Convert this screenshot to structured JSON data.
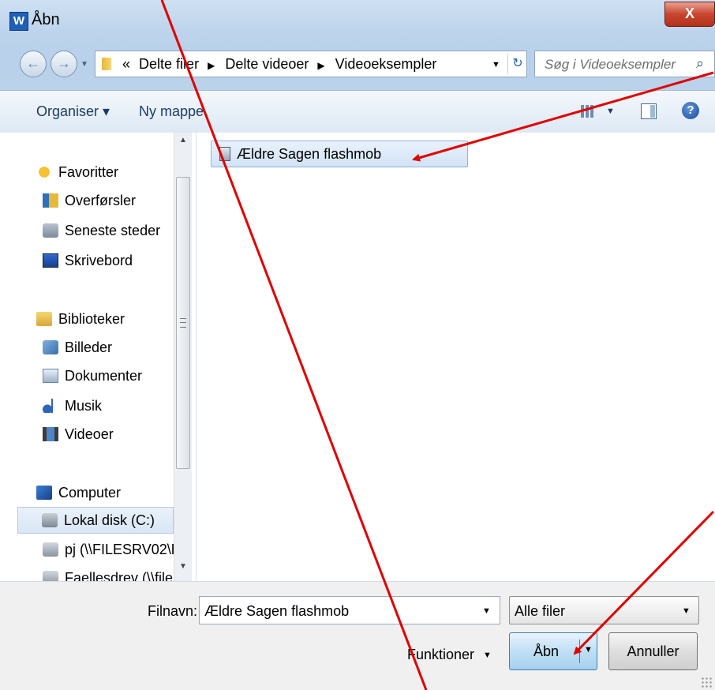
{
  "window": {
    "title": "Åbn",
    "app_icon_letter": "W",
    "close_label": "X"
  },
  "address_bar": {
    "overflow_marker": "«",
    "breadcrumbs": [
      "Delte filer",
      "Delte videoer",
      "Videoeksempler"
    ],
    "separator": "▶"
  },
  "search": {
    "placeholder": "Søg i Videoeksempler"
  },
  "toolbar": {
    "organize_label": "Organiser ▾",
    "new_folder_label": "Ny mappe"
  },
  "nav": {
    "items": [
      {
        "label": "Favoritter",
        "icon": "star-icon"
      },
      {
        "label": "Overførsler",
        "icon": "downloads-folder-icon"
      },
      {
        "label": "Seneste steder",
        "icon": "recent-places-icon"
      },
      {
        "label": "Skrivebord",
        "icon": "desktop-icon"
      },
      {
        "label": "Biblioteker",
        "icon": "libraries-icon"
      },
      {
        "label": "Billeder",
        "icon": "pictures-icon"
      },
      {
        "label": "Dokumenter",
        "icon": "documents-icon"
      },
      {
        "label": "Musik",
        "icon": "music-icon"
      },
      {
        "label": "Videoer",
        "icon": "videos-icon"
      },
      {
        "label": "Computer",
        "icon": "computer-icon"
      },
      {
        "label": "Lokal disk (C:)",
        "icon": "local-disk-icon",
        "selected": true
      },
      {
        "label": "pj (\\\\FILESRV02\\H",
        "icon": "network-drive-icon"
      },
      {
        "label": "Faellesdrev (\\\\file",
        "icon": "network-drive-icon"
      }
    ]
  },
  "files": [
    {
      "name": "Ældre Sagen flashmob",
      "icon": "video-file-icon",
      "selected": true
    }
  ],
  "bottom": {
    "filename_label": "Filnavn:",
    "filename_value": "Ældre Sagen flashmob",
    "filetype_value": "Alle filer",
    "functions_label": "Funktioner",
    "open_label": "Åbn",
    "cancel_label": "Annuller"
  },
  "colors": {
    "annotation_arrow": "#e00000",
    "selection": "#d2e3f6",
    "close_button": "#c8462f"
  }
}
